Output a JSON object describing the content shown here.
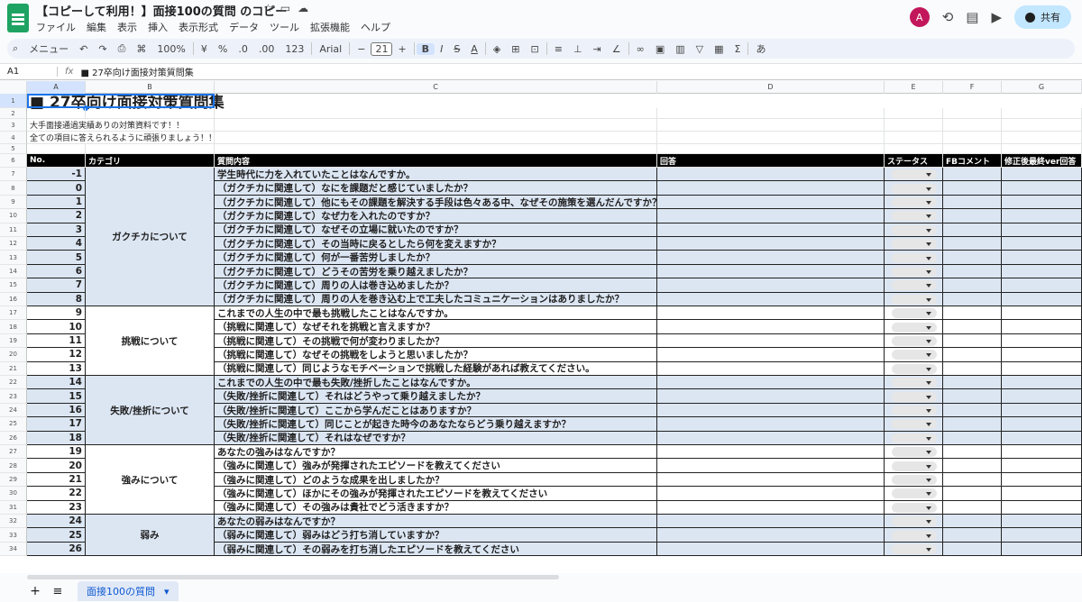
{
  "doc": {
    "title": "【コピーして利用！】面接100の質問 のコピー",
    "menu": [
      "ファイル",
      "編集",
      "表示",
      "挿入",
      "表示形式",
      "データ",
      "ツール",
      "拡張機能",
      "ヘルプ"
    ],
    "share_label": "共有",
    "avatar_letter": "A"
  },
  "toolbar": {
    "search_label": "メニュー",
    "zoom": "100%",
    "currency": "¥",
    "percent": "%",
    "dec_less": ".0",
    "dec_more": ".00",
    "num_fmt": "123",
    "font": "Arial",
    "font_size": "21",
    "bold": "B",
    "italic": "I",
    "strike": "S",
    "underline": "A",
    "input_method": "あ"
  },
  "formula": {
    "name_box": "A1",
    "fx": "fx",
    "content": "■ 27卒向け面接対策質問集"
  },
  "columns": [
    {
      "letter": "A"
    },
    {
      "letter": "B"
    },
    {
      "letter": "C"
    },
    {
      "letter": "D"
    },
    {
      "letter": "E"
    },
    {
      "letter": "F"
    },
    {
      "letter": "G"
    }
  ],
  "sheet": {
    "title": "■ 27卒向け面接対策質問集",
    "line3": "大手面接通過実績ありの対策資料です！！",
    "line4": "全ての項目に答えられるように頑張りましょう！！",
    "headers": [
      "No.",
      "カテゴリ",
      "質問内容",
      "回答",
      "ステータス",
      "FBコメント",
      "修正後最終ver回答"
    ],
    "categories": [
      "ガクチカについて",
      "挑戦について",
      "失敗/挫折について",
      "強みについて",
      "弱み"
    ],
    "rows": [
      {
        "no": "-1",
        "q": "学生時代に力を入れていたことはなんですか。"
      },
      {
        "no": "0",
        "q": "（ガクチカに関連して）なにを課題だと感じていましたか？"
      },
      {
        "no": "1",
        "q": "（ガクチカに関連して）他にもその課題を解決する手段は色々ある中、なぜその施策を選んだんですか？"
      },
      {
        "no": "2",
        "q": "（ガクチカに関連して）なぜ力を入れたのですか？"
      },
      {
        "no": "3",
        "q": "（ガクチカに関連して）なぜその立場に就いたのですか？"
      },
      {
        "no": "4",
        "q": "（ガクチカに関連して）その当時に戻るとしたら何を変えますか？"
      },
      {
        "no": "5",
        "q": "（ガクチカに関連して）何が一番苦労しましたか？"
      },
      {
        "no": "6",
        "q": "（ガクチカに関連して）どうその苦労を乗り越えましたか？"
      },
      {
        "no": "7",
        "q": "（ガクチカに関連して）周りの人は巻き込めましたか？"
      },
      {
        "no": "8",
        "q": "（ガクチカに関連して）周りの人を巻き込む上で工夫したコミュニケーションはありましたか？"
      },
      {
        "no": "9",
        "q": "これまでの人生の中で最も挑戦したことはなんですか。"
      },
      {
        "no": "10",
        "q": "（挑戦に関連して）なぜそれを挑戦と言えますか？"
      },
      {
        "no": "11",
        "q": "（挑戦に関連して）その挑戦で何が変わりましたか？"
      },
      {
        "no": "12",
        "q": "（挑戦に関連して）なぜその挑戦をしようと思いましたか？"
      },
      {
        "no": "13",
        "q": "（挑戦に関連して）同じようなモチベーションで挑戦した経験があれば教えてください。"
      },
      {
        "no": "14",
        "q": "これまでの人生の中で最も失敗/挫折したことはなんですか。"
      },
      {
        "no": "15",
        "q": "（失敗/挫折に関連して）それはどうやって乗り越えましたか？"
      },
      {
        "no": "16",
        "q": "（失敗/挫折に関連して）ここから学んだことはありますか？"
      },
      {
        "no": "17",
        "q": "（失敗/挫折に関連して）同じことが起きた時今のあなたならどう乗り越えますか？"
      },
      {
        "no": "18",
        "q": "（失敗/挫折に関連して）それはなぜですか？"
      },
      {
        "no": "19",
        "q": "あなたの強みはなんですか？"
      },
      {
        "no": "20",
        "q": "（強みに関連して）強みが発揮されたエピソードを教えてください"
      },
      {
        "no": "21",
        "q": "（強みに関連して）どのような成果を出しましたか？"
      },
      {
        "no": "22",
        "q": "（強みに関連して）ほかにその強みが発揮されたエピソードを教えてください"
      },
      {
        "no": "23",
        "q": "（強みに関連して）その強みは貴社でどう活きますか？"
      },
      {
        "no": "24",
        "q": "あなたの弱みはなんですか？"
      },
      {
        "no": "25",
        "q": "（弱みに関連して）弱みはどう打ち消していますか？"
      },
      {
        "no": "26",
        "q": "（弱みに関連して）その弱みを打ち消したエピソードを教えてください"
      }
    ]
  },
  "tabs": {
    "add": "+",
    "list": "≡",
    "active": "面接100の質問",
    "chevron": "▾"
  }
}
